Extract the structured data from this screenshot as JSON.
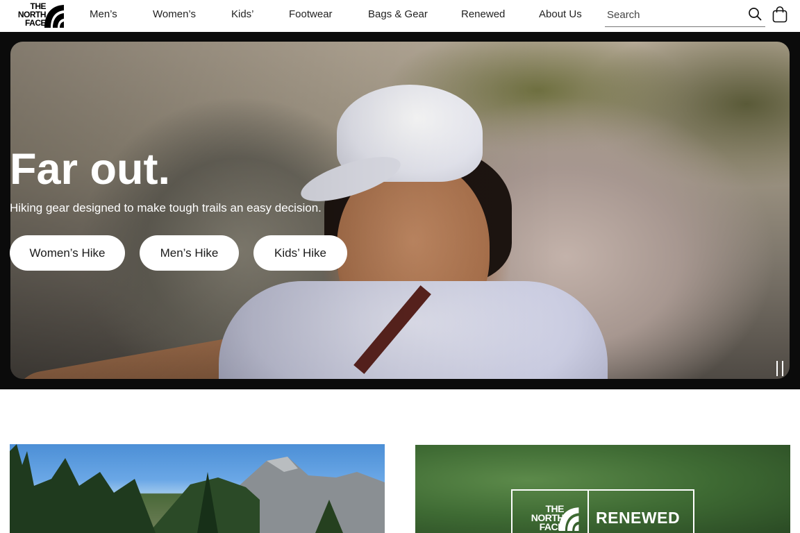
{
  "brand": {
    "logo_text": "THE NORTH FACE"
  },
  "nav": {
    "items": [
      "Men’s",
      "Women’s",
      "Kids’",
      "Footwear",
      "Bags & Gear",
      "Renewed",
      "About Us"
    ]
  },
  "search": {
    "placeholder": "Search"
  },
  "hero": {
    "title": "Far out.",
    "subtitle": "Hiking gear designed to make tough trails an easy decision.",
    "buttons": [
      "Women’s Hike",
      "Men’s Hike",
      "Kids’ Hike"
    ]
  },
  "cards": {
    "renewed": {
      "logo_text": "THE NORTH FACE",
      "label": "RENEWED"
    }
  },
  "colors": {
    "header_bg": "#ffffff",
    "hero_bg": "#0b0b0b",
    "button_bg": "#ffffff"
  }
}
